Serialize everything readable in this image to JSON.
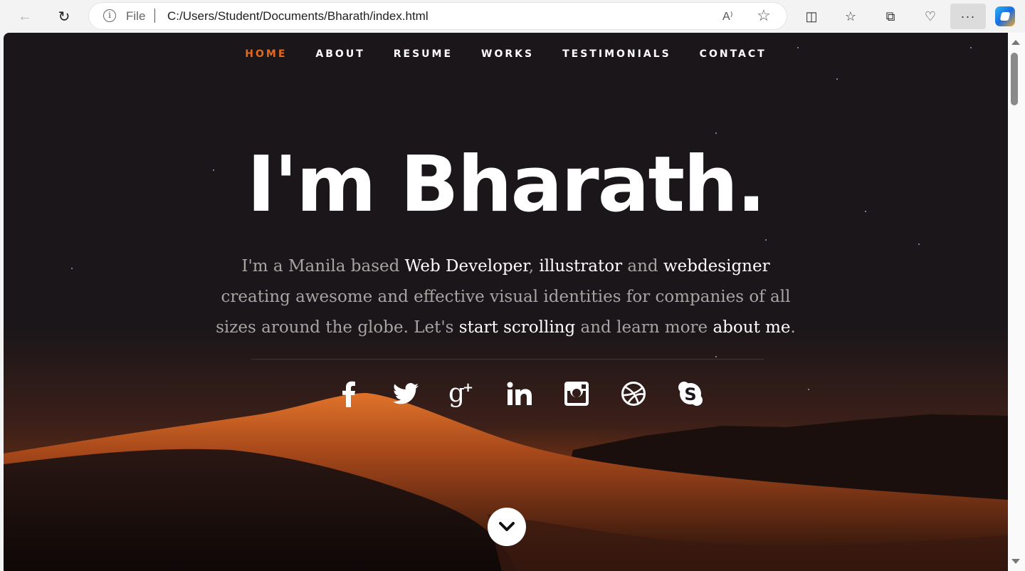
{
  "browser": {
    "file_label": "File",
    "url": "C:/Users/Student/Documents/Bharath/index.html",
    "more_label": "···",
    "read_aloud": "A⁾"
  },
  "nav": {
    "items": [
      {
        "label": "HOME",
        "active": true
      },
      {
        "label": "ABOUT"
      },
      {
        "label": "RESUME"
      },
      {
        "label": "WORKS"
      },
      {
        "label": "TESTIMONIALS"
      },
      {
        "label": "CONTACT"
      }
    ]
  },
  "hero": {
    "title": "I'm Bharath.",
    "text_1": "I'm a Manila based ",
    "link_web_developer": "Web Developer",
    "text_2": ", ",
    "link_illustrator": "illustrator",
    "text_3": " and ",
    "link_webdesigner": "webdesigner",
    "text_4": " creating awesome and effective visual identities for companies of all sizes around the globe. Let's ",
    "link_start_scrolling": "start scrolling",
    "text_5": " and learn more ",
    "link_about_me": "about me",
    "text_6": "."
  },
  "social": [
    "facebook-icon",
    "twitter-icon",
    "google-plus-icon",
    "linkedin-icon",
    "instagram-icon",
    "dribbble-icon",
    "skype-icon"
  ],
  "colors": {
    "accent": "#e2681f",
    "background": "#1b1619",
    "text_muted": "#a9a3a2"
  }
}
